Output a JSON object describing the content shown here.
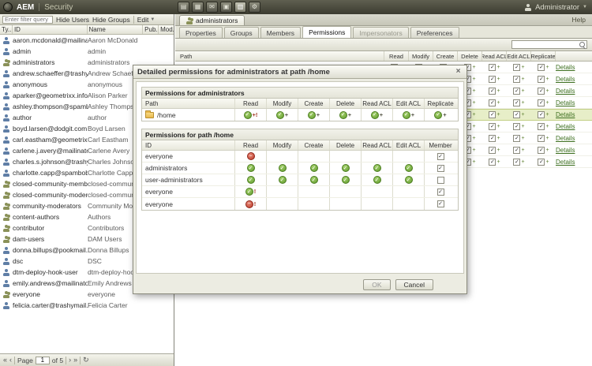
{
  "icons": {
    "close": "×",
    "check": "✓",
    "allow": "✓",
    "deny": "−",
    "plus": "+",
    "caret": "▼",
    "first": "«",
    "prev": "‹",
    "next": "›",
    "last": "»",
    "refresh": "↻"
  },
  "topbar": {
    "brand": "AEM",
    "section": "Security",
    "user": "Administrator",
    "icons": [
      {
        "name": "websites-icon",
        "glyph": "▤"
      },
      {
        "name": "assets-icon",
        "glyph": "▦"
      },
      {
        "name": "inbox-icon",
        "glyph": "✉"
      },
      {
        "name": "publications-icon",
        "glyph": "▣"
      },
      {
        "name": "security-icon",
        "glyph": "▥",
        "active": true
      },
      {
        "name": "tools-icon",
        "glyph": "⚙"
      }
    ]
  },
  "left": {
    "filter_placeholder": "Enter filter query",
    "hide_users": "Hide Users",
    "hide_groups": "Hide Groups",
    "edit": "Edit",
    "columns": [
      "Ty..",
      "ID",
      "Name",
      "Pub.",
      "Mod."
    ],
    "rows": [
      {
        "type": "user",
        "id": "aaron.mcdonald@mailinator...",
        "name": "Aaron McDonald"
      },
      {
        "type": "user",
        "id": "admin",
        "name": "admin"
      },
      {
        "type": "group",
        "id": "administrators",
        "name": "administrators"
      },
      {
        "type": "user",
        "id": "andrew.schaeffer@trashyma...",
        "name": "Andrew Schaeffer"
      },
      {
        "type": "user",
        "id": "anonymous",
        "name": "anonymous"
      },
      {
        "type": "user",
        "id": "aparker@geometrixx.info",
        "name": "Alison Parker"
      },
      {
        "type": "user",
        "id": "ashley.thompson@spambob...",
        "name": "Ashley Thompson"
      },
      {
        "type": "user",
        "id": "author",
        "name": "author"
      },
      {
        "type": "user",
        "id": "boyd.larsen@dodgit.com",
        "name": "Boyd Larsen"
      },
      {
        "type": "user",
        "id": "carl.eastham@geometrixx-m...",
        "name": "Carl Eastham"
      },
      {
        "type": "user",
        "id": "carlene.j.avery@mailinator.c...",
        "name": "Carlene Avery"
      },
      {
        "type": "user",
        "id": "charles.s.johnson@trashyma...",
        "name": "Charles Johnson"
      },
      {
        "type": "user",
        "id": "charlotte.capp@spambob.c...",
        "name": "Charlotte Capp"
      },
      {
        "type": "group",
        "id": "closed-community-members",
        "name": "closed-communit..."
      },
      {
        "type": "group",
        "id": "closed-community-moderat...",
        "name": "closed-communit..."
      },
      {
        "type": "group",
        "id": "community-moderators",
        "name": "Community Mode..."
      },
      {
        "type": "group",
        "id": "content-authors",
        "name": "Authors"
      },
      {
        "type": "group",
        "id": "contributor",
        "name": "Contributors"
      },
      {
        "type": "group",
        "id": "dam-users",
        "name": "DAM Users"
      },
      {
        "type": "user",
        "id": "donna.billups@pookmail.com",
        "name": "Donna Billups"
      },
      {
        "type": "user",
        "id": "dsc",
        "name": "DSC"
      },
      {
        "type": "user",
        "id": "dtm-deploy-hook-user",
        "name": "dtm-deploy-hook-..."
      },
      {
        "type": "user",
        "id": "emily.andrews@mailinator.co...",
        "name": "Emily Andrews"
      },
      {
        "type": "group",
        "id": "everyone",
        "name": "everyone"
      },
      {
        "type": "user",
        "id": "felicia.carter@trashymail.com",
        "name": "Felicia Carter"
      }
    ],
    "pager": {
      "page_label": "Page",
      "page_value": "1",
      "of_label": "of 5"
    }
  },
  "right": {
    "doc_tab": "administrators",
    "help": "Help",
    "tabs": [
      {
        "label": "Properties"
      },
      {
        "label": "Groups"
      },
      {
        "label": "Members"
      },
      {
        "label": "Permissions",
        "active": true
      },
      {
        "label": "Impersonators",
        "disabled": true
      },
      {
        "label": "Preferences"
      }
    ],
    "path_header": "Path",
    "grid_columns": [
      "Read",
      "Modify",
      "Create",
      "Delete",
      "Read ACL",
      "Edit ACL",
      "Replicate"
    ],
    "details_label": "Details",
    "rows": [
      {
        "selected": false
      },
      {
        "selected": false
      },
      {
        "selected": false
      },
      {
        "selected": false
      },
      {
        "selected": true
      },
      {
        "selected": false
      },
      {
        "selected": false
      },
      {
        "selected": false
      },
      {
        "selected": false
      }
    ]
  },
  "modal": {
    "title": "Detailed permissions for administrators at path /home",
    "ok": "OK",
    "cancel": "Cancel",
    "section1": {
      "title": "Permissions for administrators",
      "col0": "Path",
      "columns": [
        "Read",
        "Modify",
        "Create",
        "Delete",
        "Read ACL",
        "Edit ACL",
        "Replicate"
      ],
      "row": {
        "path": "/home",
        "cells": [
          "allow+!",
          "allow+",
          "allow+",
          "allow+",
          "allow+",
          "allow+",
          "allow+"
        ]
      }
    },
    "section2": {
      "title": "Permissions for path /home",
      "col0": "ID",
      "columns": [
        "Read",
        "Modify",
        "Create",
        "Delete",
        "Read ACL",
        "Edit ACL"
      ],
      "member_col": "Member",
      "rows": [
        {
          "id": "everyone",
          "cells": [
            "deny",
            "",
            "",
            "",
            "",
            ""
          ],
          "member": true
        },
        {
          "id": "administrators",
          "cells": [
            "allow",
            "allow",
            "allow",
            "allow",
            "allow",
            "allow"
          ],
          "member": true
        },
        {
          "id": "user-administrators",
          "cells": [
            "allow",
            "allow",
            "allow",
            "allow",
            "allow",
            "allow"
          ],
          "member": false
        },
        {
          "id": "everyone",
          "cells": [
            "allow!",
            "",
            "",
            "",
            "",
            ""
          ],
          "member": true
        },
        {
          "id": "everyone",
          "cells": [
            "deny!",
            "",
            "",
            "",
            "",
            ""
          ],
          "member": true
        }
      ]
    }
  }
}
